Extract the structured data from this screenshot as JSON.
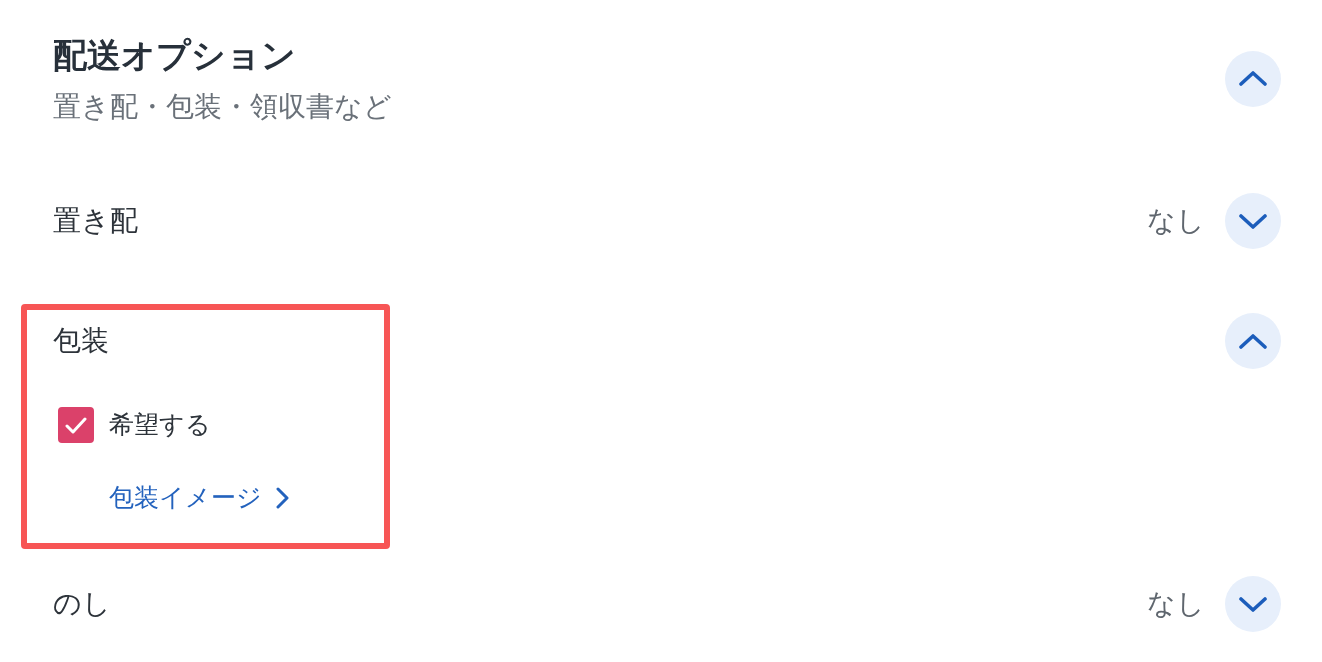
{
  "header": {
    "title": "配送オプション",
    "subtitle": "置き配・包装・領収書など",
    "expanded": true
  },
  "options": [
    {
      "label": "置き配",
      "value": "なし",
      "expanded": false,
      "highlighted": false
    },
    {
      "label": "包装",
      "expanded": true,
      "highlighted": true,
      "checkbox": {
        "label": "希望する",
        "checked": true
      },
      "link": {
        "label": "包装イメージ"
      }
    },
    {
      "label": "のし",
      "value": "なし",
      "expanded": false,
      "highlighted": false
    }
  ]
}
